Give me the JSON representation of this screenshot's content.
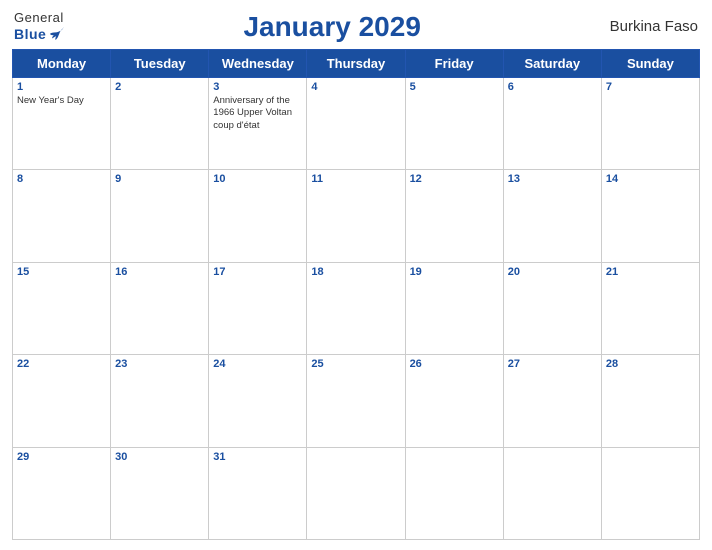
{
  "header": {
    "logo_general": "General",
    "logo_blue": "Blue",
    "title": "January 2029",
    "country": "Burkina Faso"
  },
  "weekdays": [
    "Monday",
    "Tuesday",
    "Wednesday",
    "Thursday",
    "Friday",
    "Saturday",
    "Sunday"
  ],
  "weeks": [
    [
      {
        "day": "1",
        "events": [
          "New Year's Day"
        ]
      },
      {
        "day": "2",
        "events": []
      },
      {
        "day": "3",
        "events": [
          "Anniversary of the 1966 Upper Voltan coup d'état"
        ]
      },
      {
        "day": "4",
        "events": []
      },
      {
        "day": "5",
        "events": []
      },
      {
        "day": "6",
        "events": []
      },
      {
        "day": "7",
        "events": []
      }
    ],
    [
      {
        "day": "8",
        "events": []
      },
      {
        "day": "9",
        "events": []
      },
      {
        "day": "10",
        "events": []
      },
      {
        "day": "11",
        "events": []
      },
      {
        "day": "12",
        "events": []
      },
      {
        "day": "13",
        "events": []
      },
      {
        "day": "14",
        "events": []
      }
    ],
    [
      {
        "day": "15",
        "events": []
      },
      {
        "day": "16",
        "events": []
      },
      {
        "day": "17",
        "events": []
      },
      {
        "day": "18",
        "events": []
      },
      {
        "day": "19",
        "events": []
      },
      {
        "day": "20",
        "events": []
      },
      {
        "day": "21",
        "events": []
      }
    ],
    [
      {
        "day": "22",
        "events": []
      },
      {
        "day": "23",
        "events": []
      },
      {
        "day": "24",
        "events": []
      },
      {
        "day": "25",
        "events": []
      },
      {
        "day": "26",
        "events": []
      },
      {
        "day": "27",
        "events": []
      },
      {
        "day": "28",
        "events": []
      }
    ],
    [
      {
        "day": "29",
        "events": []
      },
      {
        "day": "30",
        "events": []
      },
      {
        "day": "31",
        "events": []
      },
      {
        "day": "",
        "events": []
      },
      {
        "day": "",
        "events": []
      },
      {
        "day": "",
        "events": []
      },
      {
        "day": "",
        "events": []
      }
    ]
  ]
}
